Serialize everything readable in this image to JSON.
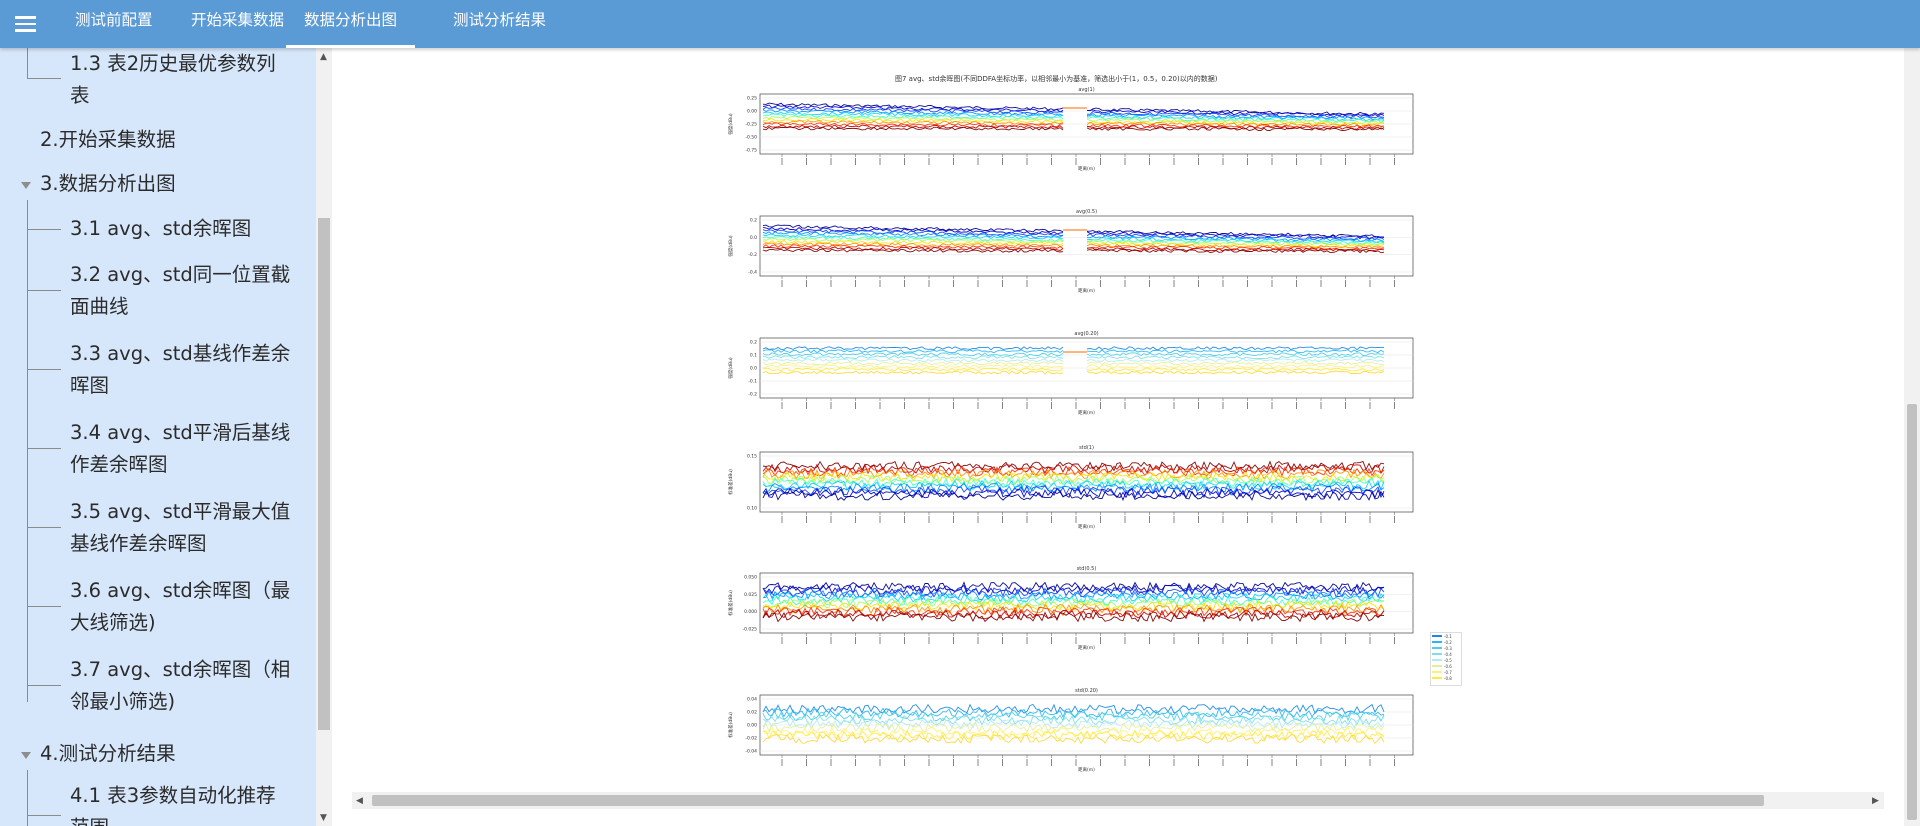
{
  "topbar": {
    "tabs": [
      {
        "label": "测试前配置"
      },
      {
        "label": "开始采集数据"
      },
      {
        "label": "数据分析出图",
        "active": true
      },
      {
        "label": "测试分析结果"
      }
    ]
  },
  "sidebar": {
    "items": [
      {
        "label_lines": [
          "1.3 表2历史最优参数列",
          "表"
        ]
      },
      {
        "label_lines": [
          "2.开始采集数据"
        ]
      },
      {
        "label_lines": [
          "3.数据分析出图"
        ]
      },
      {
        "label_lines": [
          "3.1 avg、std余晖图"
        ]
      },
      {
        "label_lines": [
          "3.2 avg、std同一位置截",
          "面曲线"
        ]
      },
      {
        "label_lines": [
          "3.3 avg、std基线作差余",
          "晖图"
        ]
      },
      {
        "label_lines": [
          "3.4 avg、std平滑后基线",
          "作差余晖图"
        ]
      },
      {
        "label_lines": [
          "3.5 avg、std平滑最大值",
          "基线作差余晖图"
        ]
      },
      {
        "label_lines": [
          "3.6 avg、std余晖图（最",
          "大线筛选)"
        ]
      },
      {
        "label_lines": [
          "3.7 avg、std余晖图（相",
          "邻最小筛选)"
        ]
      },
      {
        "label_lines": [
          "4.测试分析结果"
        ]
      },
      {
        "label_lines": [
          "4.1 表3参数自动化推荐",
          "范围"
        ]
      }
    ]
  },
  "colors": {
    "topbar": "#5b9bd5",
    "sidebar": "#d7e7fb",
    "jet_high": "#800000",
    "jet_low": "#00008f",
    "cyan": "#2fd6f0",
    "yellow": "#f7ea16"
  },
  "figure": {
    "title": "图7 avg、std余晖图(不同DDFA坐标功率，以相邻最小为基准，筛选出小于(1，0.5，0.20)以内的数据)",
    "chart_data": [
      {
        "type": "line",
        "title": "avg(1)",
        "ylabel": "强度(dBu)",
        "xlabel": "距离(m)",
        "yticks": [
          "0.25",
          "0.00",
          "-0.25",
          "-0.50",
          "-0.75"
        ],
        "ylim": [
          -0.75,
          0.25
        ],
        "colormap": "jet"
      },
      {
        "type": "line",
        "title": "avg(0.5)",
        "ylabel": "强度(dBu)",
        "xlabel": "距离(m)",
        "yticks": [
          "0.2",
          "0.0",
          "-0.2",
          "-0.4"
        ],
        "ylim": [
          -0.5,
          0.2
        ],
        "colormap": "jet"
      },
      {
        "type": "line",
        "title": "avg(0.20)",
        "ylabel": "强度(dBu)",
        "xlabel": "距离(m)",
        "yticks": [
          "0.2",
          "0.1",
          "0.0",
          "-0.1",
          "-0.2"
        ],
        "ylim": [
          -0.2,
          0.2
        ],
        "colormap": "cyan-yellow"
      },
      {
        "type": "line",
        "title": "std(1)",
        "ylabel": "标准差(dBu)",
        "xlabel": "距离(m)",
        "yticks": [
          "0.15",
          "0.10"
        ],
        "ylim": [
          0.08,
          0.17
        ],
        "colormap": "jet"
      },
      {
        "type": "line",
        "title": "std(0.5)",
        "ylabel": "标准差(dBu)",
        "xlabel": "距离(m)",
        "yticks": [
          "0.050",
          "0.025",
          "0.000",
          "-0.025"
        ],
        "ylim": [
          -0.035,
          0.055
        ],
        "colormap": "jet"
      },
      {
        "type": "line",
        "title": "std(0.20)",
        "ylabel": "标准差(dBu)",
        "xlabel": "距离(m)",
        "yticks": [
          "0.04",
          "0.02",
          "0.00",
          "-0.02",
          "-0.04"
        ],
        "ylim": [
          -0.045,
          0.045
        ],
        "colormap": "cyan-yellow"
      }
    ],
    "legend": [
      "-0.1",
      "-0.2",
      "-0.3",
      "-0.4",
      "-0.5",
      "-0.6",
      "-0.7",
      "-0.8"
    ]
  }
}
